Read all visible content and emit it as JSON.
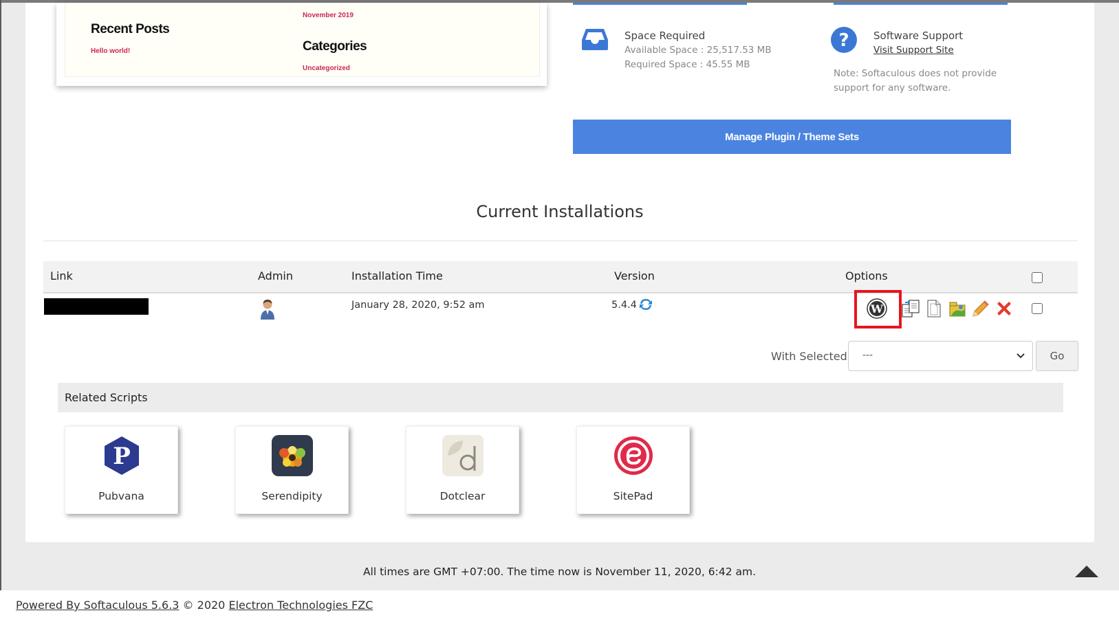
{
  "preview": {
    "date": "November 2019",
    "recent_posts_heading": "Recent Posts",
    "recent_post_link": "Hello world!",
    "categories_heading": "Categories",
    "category_link": "Uncategorized"
  },
  "space": {
    "title": "Space Required",
    "available": "Available Space : 25,517.53 MB",
    "required": "Required Space : 45.55 MB",
    "icon": "inbox-icon"
  },
  "support": {
    "title": "Software Support",
    "link": "Visit Support Site",
    "note_line1": "Note: Softaculous does not provide",
    "note_line2": "support for any software.",
    "icon": "question-icon"
  },
  "manage_button": "Manage Plugin / Theme Sets",
  "section_title": "Current Installations",
  "table": {
    "headers": {
      "link": "Link",
      "admin": "Admin",
      "time": "Installation Time",
      "version": "Version",
      "options": "Options"
    },
    "rows": [
      {
        "installation_time": "January 28, 2020, 9:52 am",
        "version": "5.4.4"
      }
    ]
  },
  "with_selected": {
    "label": "With Selected:",
    "value": "---",
    "go": "Go"
  },
  "related": {
    "title": "Related Scripts",
    "scripts": [
      {
        "name": "Pubvana"
      },
      {
        "name": "Serendipity"
      },
      {
        "name": "Dotclear"
      },
      {
        "name": "SitePad"
      }
    ]
  },
  "time_note": "All times are GMT +07:00. The time now is November 11, 2020, 6:42 am.",
  "footer": {
    "powered": "Powered By Softaculous 5.6.3",
    "copyright": " © 2020 ",
    "company": "Electron Technologies FZC"
  },
  "colors": {
    "accent": "#4a84e0",
    "highlight": "#e8141e",
    "preview_link": "#cd2653"
  }
}
